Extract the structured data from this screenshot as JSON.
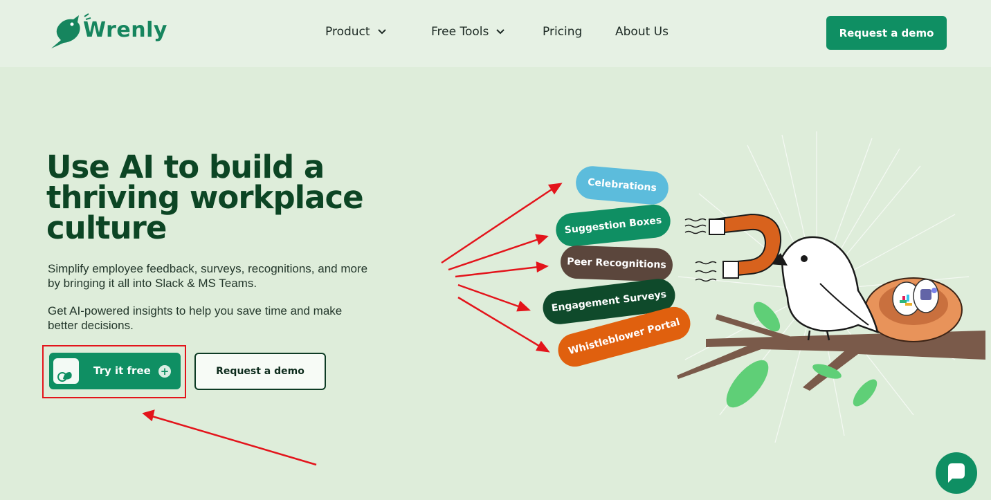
{
  "brand": {
    "name": "Wrenly",
    "color": "#16855e"
  },
  "nav": {
    "items": [
      {
        "label": "Product",
        "dropdown": true
      },
      {
        "label": "Free Tools",
        "dropdown": true
      },
      {
        "label": "Pricing",
        "dropdown": false
      },
      {
        "label": "About Us",
        "dropdown": false
      }
    ],
    "cta": "Request a demo"
  },
  "hero": {
    "headline_lines": [
      "Use AI to build a",
      "thriving workplace",
      "culture"
    ],
    "paragraph1": "Simplify employee feedback, surveys, recognitions, and more by bringing it all into Slack & MS Teams.",
    "paragraph2": "Get AI-powered insights to help you save time and make better decisions.",
    "primary_button": "Try it free",
    "secondary_button": "Request a demo"
  },
  "features": [
    {
      "label": "Celebrations",
      "color": "#5cbcdc"
    },
    {
      "label": "Suggestion Boxes",
      "color": "#0f8f63"
    },
    {
      "label": "Peer Recognitions",
      "color": "#5b463c"
    },
    {
      "label": "Engagement Surveys",
      "color": "#0f4a2b"
    },
    {
      "label": "Whistleblower Portal",
      "color": "#e0600e"
    }
  ],
  "colors": {
    "accent": "#0f8f63",
    "annotation": "#e3141b",
    "headline": "#0c4524"
  },
  "icons": [
    "chevron-down-icon",
    "bird-icon",
    "plus-icon",
    "chat-icon",
    "magnet-icon",
    "slack-icon",
    "teams-icon"
  ]
}
